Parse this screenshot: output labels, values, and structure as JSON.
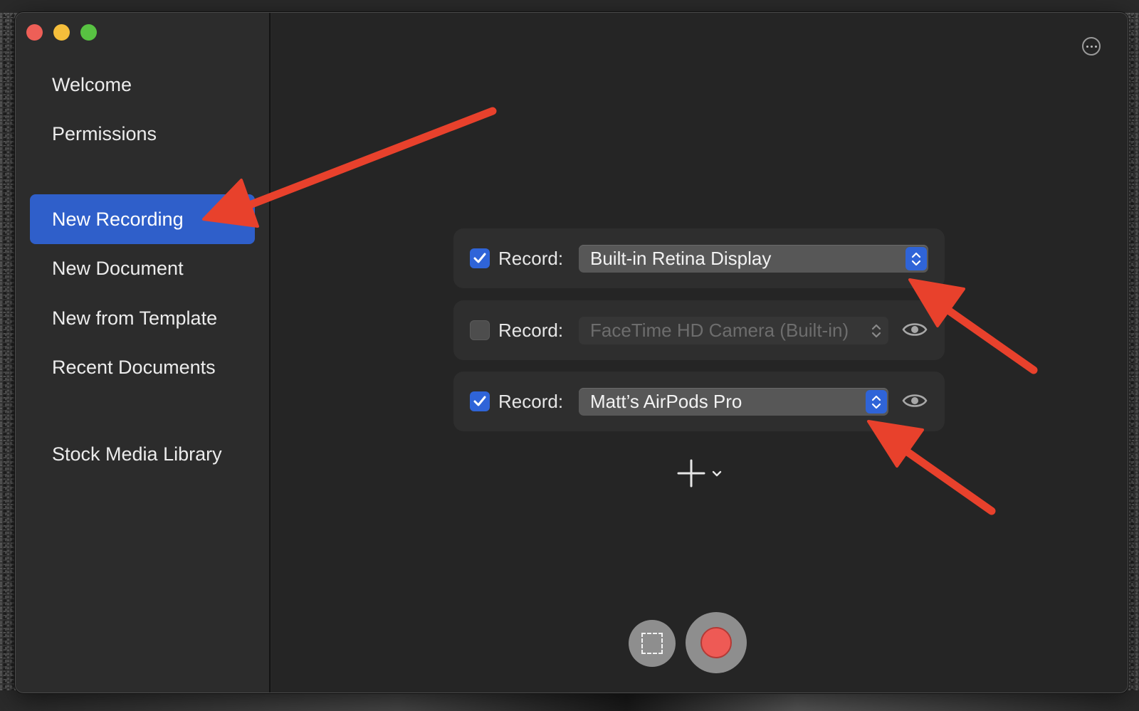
{
  "sidebar": {
    "items": [
      {
        "label": "Welcome"
      },
      {
        "label": "Permissions"
      },
      {
        "label": "New Recording",
        "active": true
      },
      {
        "label": "New Document"
      },
      {
        "label": "New from Template"
      },
      {
        "label": "Recent Documents"
      },
      {
        "label": "Stock Media Library"
      }
    ]
  },
  "recording": {
    "rows": [
      {
        "checked": true,
        "label": "Record:",
        "device": "Built-in Retina Display",
        "enabled": true
      },
      {
        "checked": false,
        "label": "Record:",
        "device": "FaceTime HD Camera (Built-in)",
        "enabled": false
      },
      {
        "checked": true,
        "label": "Record:",
        "device": "Matt’s AirPods Pro",
        "enabled": true
      }
    ]
  },
  "colors": {
    "accent": "#2f64d8",
    "sidebar_selected": "#2f5fca",
    "record": "#ee5a55",
    "annotation_arrow": "#e8412c"
  },
  "icons": {
    "more": "ellipsis-circle-icon",
    "eye": "eye-icon",
    "add": "plus-icon",
    "capture": "dashed-selection-icon",
    "record": "record-icon"
  }
}
